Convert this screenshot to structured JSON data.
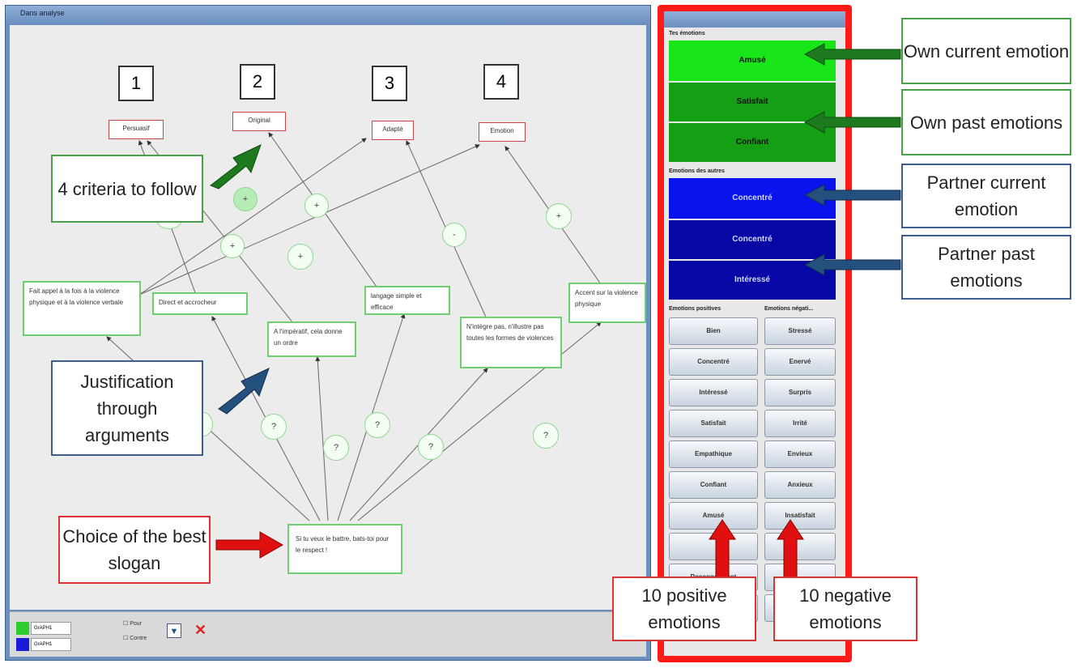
{
  "window": {
    "title": "Dans analyse"
  },
  "criteria_numbers": [
    "1",
    "2",
    "3",
    "4"
  ],
  "criteria": [
    "Persuasif",
    "Original",
    "Adapté",
    "Emotion"
  ],
  "arguments": {
    "a1": "Fait appel à la fois à la violence physique et à la violence verbale",
    "a2": "Direct et accrocheur",
    "a3": "A l'impératif, cela donne un ordre",
    "a4": "langage simple et efficace",
    "a5": "N'intègre pas, n'illustre pas toutes les formes de violences",
    "a6": "Accent sur la violence physique"
  },
  "slogan": "Si tu veux le battre, bats-toi pour le respect !",
  "node_labels": {
    "plus": "+",
    "minus": "-",
    "question": "?"
  },
  "footer": {
    "user1": "GrAPH1",
    "user2": "GrAPH1",
    "check1": "Pour",
    "check2": "Contre",
    "delete": "✕"
  },
  "callouts": {
    "criteria": "4 criteria to follow",
    "justification": "Justification through arguments",
    "choice": "Choice of the best slogan"
  },
  "panel": {
    "own_header": "Tes émotions",
    "own_current": "Amusé",
    "own_past": [
      "Satisfait",
      "Confiant"
    ],
    "others_header": "Emotions des autres",
    "partner_current": "Concentré",
    "partner_past": [
      "Concentré",
      "Intéressé"
    ],
    "pos_header": "Emotions positives",
    "neg_header": "Emotions négati...",
    "positive": [
      "Bien",
      "Concentré",
      "Intéressé",
      "Satisfait",
      "Empathique",
      "Confiant",
      "Amusé",
      "",
      "Reconnaissant",
      ""
    ],
    "negative": [
      "Stressé",
      "Enervé",
      "Surpris",
      "Irrité",
      "Envieux",
      "Anxieux",
      "Insatisfait",
      "",
      "",
      ""
    ],
    "colors": {
      "own_current": "#19e619",
      "own_past": "#159f15",
      "partner_current": "#0a12ee",
      "partner_past": "#0707a6"
    }
  },
  "annotations": {
    "own_current": "Own current emotion",
    "own_past": "Own past emotions",
    "partner_current": "Partner current emotion",
    "partner_past": "Partner past emotions",
    "positive": "10 positive emotions",
    "negative": "10 negative emotions"
  }
}
